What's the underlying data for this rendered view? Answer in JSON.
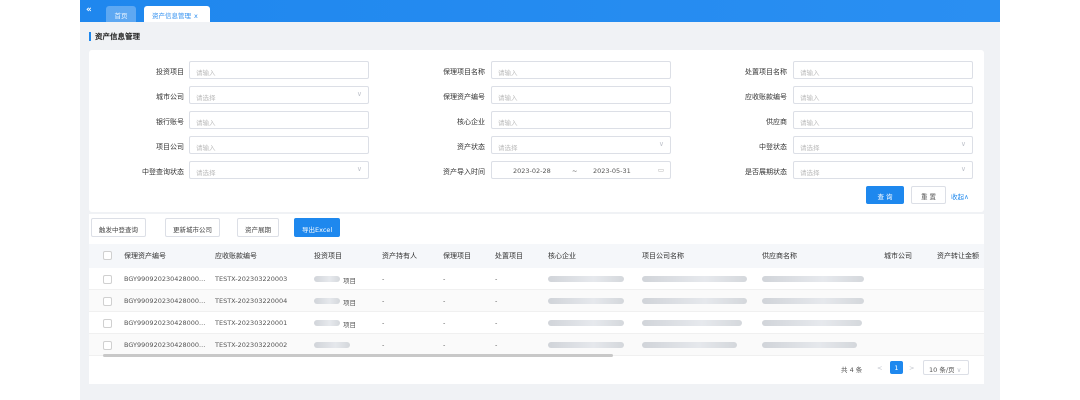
{
  "tabs": {
    "collapse": "«",
    "home": "首页",
    "active": "资产信息管理",
    "close": "x"
  },
  "page_title": "资产信息管理",
  "filters": {
    "invest_project": {
      "label": "投资项目",
      "placeholder": "请输入"
    },
    "city_company": {
      "label": "城市公司",
      "placeholder": "请选择"
    },
    "bank_account": {
      "label": "银行账号",
      "placeholder": "请输入"
    },
    "project_company": {
      "label": "项目公司",
      "placeholder": "请输入"
    },
    "zd_query_status": {
      "label": "中登查询状态",
      "placeholder": "请选择"
    },
    "factoring_name": {
      "label": "保理项目名称",
      "placeholder": "请输入"
    },
    "factoring_asset_no": {
      "label": "保理资产编号",
      "placeholder": "请输入"
    },
    "core_enterprise": {
      "label": "核心企业",
      "placeholder": "请输入"
    },
    "asset_status": {
      "label": "资产状态",
      "placeholder": "请选择"
    },
    "import_time": {
      "label": "资产导入时间",
      "start": "2023-02-28",
      "sep": "~",
      "end": "2023-05-31"
    },
    "disposal_name": {
      "label": "处置项目名称",
      "placeholder": "请输入"
    },
    "receivable_no": {
      "label": "应收账款编号",
      "placeholder": "请输入"
    },
    "supplier": {
      "label": "供应商",
      "placeholder": "请输入"
    },
    "zd_status": {
      "label": "中登状态",
      "placeholder": "请选择"
    },
    "is_extended": {
      "label": "是否展期状态",
      "placeholder": "请选择"
    }
  },
  "buttons": {
    "query": "查 询",
    "reset": "重 置",
    "collapse": "收起∧"
  },
  "actions": [
    "触发中登查询",
    "更新城市公司",
    "资产展期",
    "导出Excel"
  ],
  "columns": [
    "保理资产编号",
    "应收账款编号",
    "投资项目",
    "资产持有人",
    "保理项目",
    "处置项目",
    "核心企业",
    "项目公司名称",
    "供应商名称",
    "城市公司",
    "资产转让金额"
  ],
  "rows": [
    {
      "asset_no": "BGY990920230428000...",
      "receivable_no": "TESTX-202303220003",
      "invest": "项目",
      "holder": "-",
      "factoring": "-",
      "disposal": "-"
    },
    {
      "asset_no": "BGY990920230428000...",
      "receivable_no": "TESTX-202303220004",
      "invest": "项目",
      "holder": "-",
      "factoring": "-",
      "disposal": "-"
    },
    {
      "asset_no": "BGY990920230428000...",
      "receivable_no": "TESTX-202303220001",
      "invest": "项目",
      "holder": "-",
      "factoring": "-",
      "disposal": "-"
    },
    {
      "asset_no": "BGY990920230428000...",
      "receivable_no": "TESTX-202303220002",
      "invest": "",
      "holder": "-",
      "factoring": "-",
      "disposal": "-"
    }
  ],
  "pagination": {
    "total": "共 4 条",
    "prev": "<",
    "current": "1",
    "next": ">",
    "page_size": "10 条/页"
  }
}
